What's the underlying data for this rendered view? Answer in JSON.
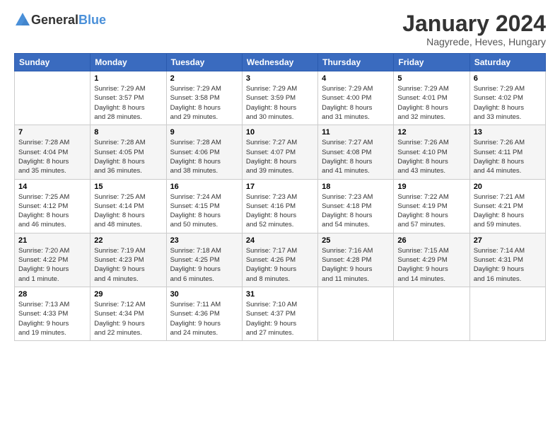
{
  "header": {
    "logo_general": "General",
    "logo_blue": "Blue",
    "title": "January 2024",
    "subtitle": "Nagyrede, Heves, Hungary"
  },
  "calendar": {
    "days_of_week": [
      "Sunday",
      "Monday",
      "Tuesday",
      "Wednesday",
      "Thursday",
      "Friday",
      "Saturday"
    ],
    "weeks": [
      [
        {
          "day": "",
          "info": ""
        },
        {
          "day": "1",
          "info": "Sunrise: 7:29 AM\nSunset: 3:57 PM\nDaylight: 8 hours\nand 28 minutes."
        },
        {
          "day": "2",
          "info": "Sunrise: 7:29 AM\nSunset: 3:58 PM\nDaylight: 8 hours\nand 29 minutes."
        },
        {
          "day": "3",
          "info": "Sunrise: 7:29 AM\nSunset: 3:59 PM\nDaylight: 8 hours\nand 30 minutes."
        },
        {
          "day": "4",
          "info": "Sunrise: 7:29 AM\nSunset: 4:00 PM\nDaylight: 8 hours\nand 31 minutes."
        },
        {
          "day": "5",
          "info": "Sunrise: 7:29 AM\nSunset: 4:01 PM\nDaylight: 8 hours\nand 32 minutes."
        },
        {
          "day": "6",
          "info": "Sunrise: 7:29 AM\nSunset: 4:02 PM\nDaylight: 8 hours\nand 33 minutes."
        }
      ],
      [
        {
          "day": "7",
          "info": "Sunrise: 7:28 AM\nSunset: 4:04 PM\nDaylight: 8 hours\nand 35 minutes."
        },
        {
          "day": "8",
          "info": "Sunrise: 7:28 AM\nSunset: 4:05 PM\nDaylight: 8 hours\nand 36 minutes."
        },
        {
          "day": "9",
          "info": "Sunrise: 7:28 AM\nSunset: 4:06 PM\nDaylight: 8 hours\nand 38 minutes."
        },
        {
          "day": "10",
          "info": "Sunrise: 7:27 AM\nSunset: 4:07 PM\nDaylight: 8 hours\nand 39 minutes."
        },
        {
          "day": "11",
          "info": "Sunrise: 7:27 AM\nSunset: 4:08 PM\nDaylight: 8 hours\nand 41 minutes."
        },
        {
          "day": "12",
          "info": "Sunrise: 7:26 AM\nSunset: 4:10 PM\nDaylight: 8 hours\nand 43 minutes."
        },
        {
          "day": "13",
          "info": "Sunrise: 7:26 AM\nSunset: 4:11 PM\nDaylight: 8 hours\nand 44 minutes."
        }
      ],
      [
        {
          "day": "14",
          "info": "Sunrise: 7:25 AM\nSunset: 4:12 PM\nDaylight: 8 hours\nand 46 minutes."
        },
        {
          "day": "15",
          "info": "Sunrise: 7:25 AM\nSunset: 4:14 PM\nDaylight: 8 hours\nand 48 minutes."
        },
        {
          "day": "16",
          "info": "Sunrise: 7:24 AM\nSunset: 4:15 PM\nDaylight: 8 hours\nand 50 minutes."
        },
        {
          "day": "17",
          "info": "Sunrise: 7:23 AM\nSunset: 4:16 PM\nDaylight: 8 hours\nand 52 minutes."
        },
        {
          "day": "18",
          "info": "Sunrise: 7:23 AM\nSunset: 4:18 PM\nDaylight: 8 hours\nand 54 minutes."
        },
        {
          "day": "19",
          "info": "Sunrise: 7:22 AM\nSunset: 4:19 PM\nDaylight: 8 hours\nand 57 minutes."
        },
        {
          "day": "20",
          "info": "Sunrise: 7:21 AM\nSunset: 4:21 PM\nDaylight: 8 hours\nand 59 minutes."
        }
      ],
      [
        {
          "day": "21",
          "info": "Sunrise: 7:20 AM\nSunset: 4:22 PM\nDaylight: 9 hours\nand 1 minute."
        },
        {
          "day": "22",
          "info": "Sunrise: 7:19 AM\nSunset: 4:23 PM\nDaylight: 9 hours\nand 4 minutes."
        },
        {
          "day": "23",
          "info": "Sunrise: 7:18 AM\nSunset: 4:25 PM\nDaylight: 9 hours\nand 6 minutes."
        },
        {
          "day": "24",
          "info": "Sunrise: 7:17 AM\nSunset: 4:26 PM\nDaylight: 9 hours\nand 8 minutes."
        },
        {
          "day": "25",
          "info": "Sunrise: 7:16 AM\nSunset: 4:28 PM\nDaylight: 9 hours\nand 11 minutes."
        },
        {
          "day": "26",
          "info": "Sunrise: 7:15 AM\nSunset: 4:29 PM\nDaylight: 9 hours\nand 14 minutes."
        },
        {
          "day": "27",
          "info": "Sunrise: 7:14 AM\nSunset: 4:31 PM\nDaylight: 9 hours\nand 16 minutes."
        }
      ],
      [
        {
          "day": "28",
          "info": "Sunrise: 7:13 AM\nSunset: 4:33 PM\nDaylight: 9 hours\nand 19 minutes."
        },
        {
          "day": "29",
          "info": "Sunrise: 7:12 AM\nSunset: 4:34 PM\nDaylight: 9 hours\nand 22 minutes."
        },
        {
          "day": "30",
          "info": "Sunrise: 7:11 AM\nSunset: 4:36 PM\nDaylight: 9 hours\nand 24 minutes."
        },
        {
          "day": "31",
          "info": "Sunrise: 7:10 AM\nSunset: 4:37 PM\nDaylight: 9 hours\nand 27 minutes."
        },
        {
          "day": "",
          "info": ""
        },
        {
          "day": "",
          "info": ""
        },
        {
          "day": "",
          "info": ""
        }
      ]
    ]
  }
}
